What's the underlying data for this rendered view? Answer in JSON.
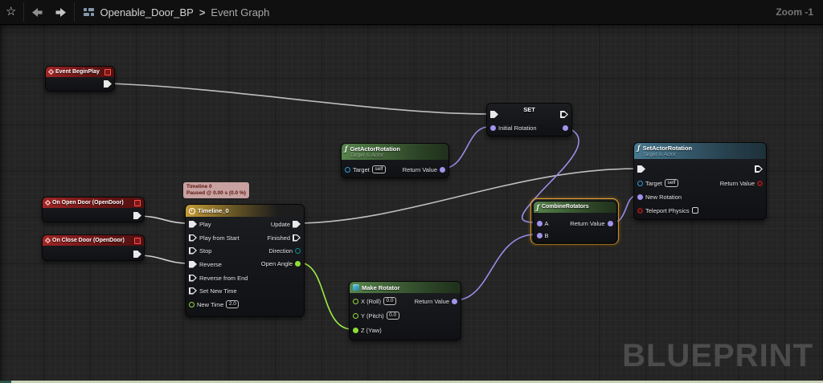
{
  "toolbar": {
    "breadcrumb": {
      "root": "Openable_Door_BP",
      "separator": ">",
      "current": "Event Graph"
    },
    "zoom_label": "Zoom -1"
  },
  "watermark": "BLUEPRINT",
  "colors": {
    "exec_pin": "#e9e9e9",
    "rotator_pin": "#a194ee",
    "object_pin": "#2f9ad6",
    "float_pin": "#8fdd38",
    "bool_pin": "#8e1a1a",
    "enum_pin": "#0d8a8f",
    "selection": "#f0a62f",
    "event_header": "#a02525",
    "function_header": "#57844c",
    "pure_header": "#46788f",
    "timeline_header": "#c59d36",
    "comment_bg": "#c7a2a0"
  },
  "nodes": {
    "event_begin_play": {
      "title": "Event BeginPlay"
    },
    "on_open_door": {
      "title": "On Open Door (OpenDoor)"
    },
    "on_close_door": {
      "title": "On Close Door (OpenDoor)"
    },
    "set": {
      "title": "SET",
      "pin_label": "Initial Rotation"
    },
    "get_actor_rotation": {
      "title": "GetActorRotation",
      "subtitle": "Target is Actor",
      "target_label": "Target",
      "target_value": "self",
      "return_label": "Return Value"
    },
    "set_actor_rotation": {
      "title": "SetActorRotation",
      "subtitle": "Target is Actor",
      "target_label": "Target",
      "target_value": "self",
      "return_label": "Return Value",
      "new_rotation_label": "New Rotation",
      "teleport_label": "Teleport Physics"
    },
    "timeline": {
      "comment_line1": "Timeline 0",
      "comment_line2": "Paused @ 0.00 s (0.0 %)",
      "title": "Timeline_0",
      "inputs": [
        "Play",
        "Play from Start",
        "Stop",
        "Reverse",
        "Reverse from End",
        "Set New Time",
        "New Time"
      ],
      "new_time_value": "2.0",
      "outputs": [
        "Update",
        "Finished",
        "Direction",
        "Open Angle"
      ]
    },
    "combine_rotators": {
      "title": "CombineRotators",
      "a_label": "A",
      "b_label": "B",
      "return_label": "Return Value"
    },
    "make_rotator": {
      "title": "Make Rotator",
      "x_label": "X (Roll)",
      "x_value": "0.0",
      "y_label": "Y (Pitch)",
      "y_value": "0.0",
      "z_label": "Z (Yaw)",
      "return_label": "Return Value"
    }
  }
}
